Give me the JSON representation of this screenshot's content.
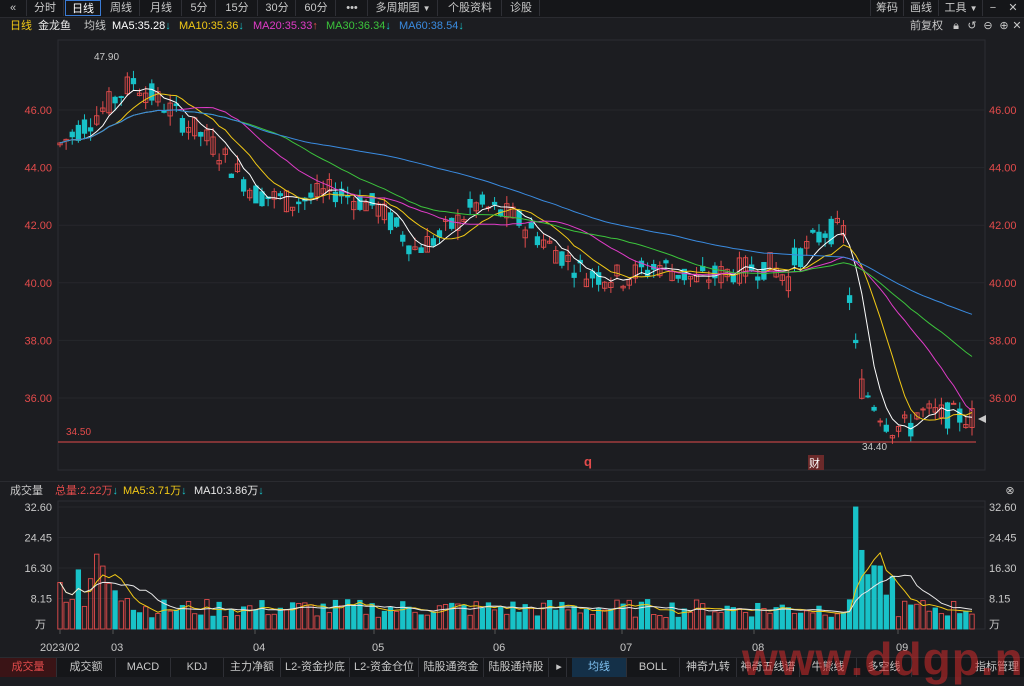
{
  "toolbar": {
    "back_icon": "double-chevron-left-icon",
    "items": [
      "分时",
      "日线",
      "周线",
      "月线",
      "5分",
      "15分",
      "30分",
      "60分",
      "•••",
      "多周期图",
      "个股资料",
      "诊股"
    ],
    "active": "日线",
    "right_items": [
      "筹码",
      "画线",
      "工具"
    ]
  },
  "ma_header": {
    "period": "日线",
    "stock_name": "金龙鱼",
    "line_type": "均线",
    "ma5": "MA5:35.28",
    "ma10": "MA10:35.36",
    "ma20": "MA20:35.33",
    "ma30": "MA30:36.34",
    "ma60": "MA60:38.54",
    "adjust": "前复权",
    "ma5_dir": "↓",
    "ma10_dir": "↓",
    "ma20_dir": "↑",
    "ma30_dir": "↓",
    "ma60_dir": "↓"
  },
  "colors": {
    "up": "#e24b4b",
    "down": "#18c2c8",
    "ma5": "#ffffff",
    "ma10": "#f2c916",
    "ma20": "#e03cc8",
    "ma30": "#3cc43c",
    "ma60": "#3a8be0",
    "axis_text": "#e24b4b"
  },
  "price_axis": {
    "ticks": [
      "46.00",
      "44.00",
      "42.00",
      "40.00",
      "38.00",
      "36.00"
    ],
    "high_label": "47.90",
    "low_label": "34.40",
    "ref_line_label": "34.50",
    "marker_q": "q",
    "marker_cai": "财"
  },
  "volume_header": {
    "title": "成交量",
    "total": "总量:2.22万",
    "total_dir": "↓",
    "ma5": "MA5:3.71万",
    "ma5_dir": "↓",
    "ma10": "MA10:3.86万",
    "ma10_dir": "↓"
  },
  "volume_axis": {
    "ticks": [
      "32.60",
      "24.45",
      "16.30",
      "8.15"
    ],
    "unit": "万"
  },
  "date_axis": [
    "2023/02",
    "03",
    "04",
    "05",
    "06",
    "07",
    "08",
    "09"
  ],
  "bottom_tabs": [
    "成交量",
    "成交额",
    "MACD",
    "KDJ",
    "主力净额",
    "L2-资金抄底",
    "L2-资金仓位",
    "陆股通资金",
    "陆股通持股"
  ],
  "bottom_tabs_right": [
    "均线",
    "BOLL",
    "神奇九转",
    "神奇五线谱",
    "牛熊线",
    "多空线",
    "指标管理"
  ],
  "watermark": "www.ddgp.net",
  "chart_data": {
    "type": "candlestick",
    "ylim": [
      34.5,
      48.0
    ],
    "volume_ylim": [
      0,
      32.6
    ],
    "series_names": [
      "MA5",
      "MA10",
      "MA20",
      "MA30",
      "MA60"
    ]
  }
}
